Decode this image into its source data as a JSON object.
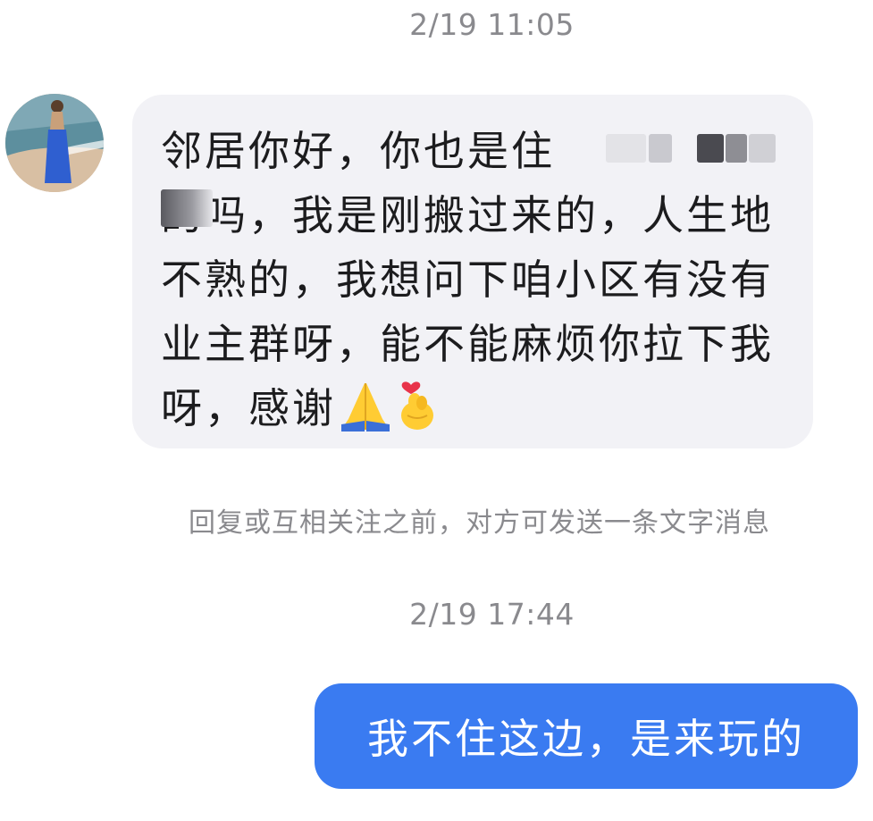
{
  "chat": {
    "messages": [
      {
        "timestamp": "2/19 11:05",
        "sender": "incoming",
        "text": "邻居你好，你也是住\n的吗，我是刚搬过来的，人生地不熟的，我想问下咱小区有没有业主群呀，能不能麻烦你拉下我呀，感谢",
        "emojis": [
          "folded-hands",
          "heart-fingers"
        ]
      },
      {
        "timestamp": "2/19 17:44",
        "sender": "outgoing",
        "text": "我不住这边，是来玩的"
      }
    ],
    "notice": "回复或互相关注之前，对方可发送一条文字消息"
  },
  "colors": {
    "incoming_bubble": "#f2f2f6",
    "outgoing_bubble": "#3a7bf1",
    "timestamp_text": "#8a8a8e"
  }
}
